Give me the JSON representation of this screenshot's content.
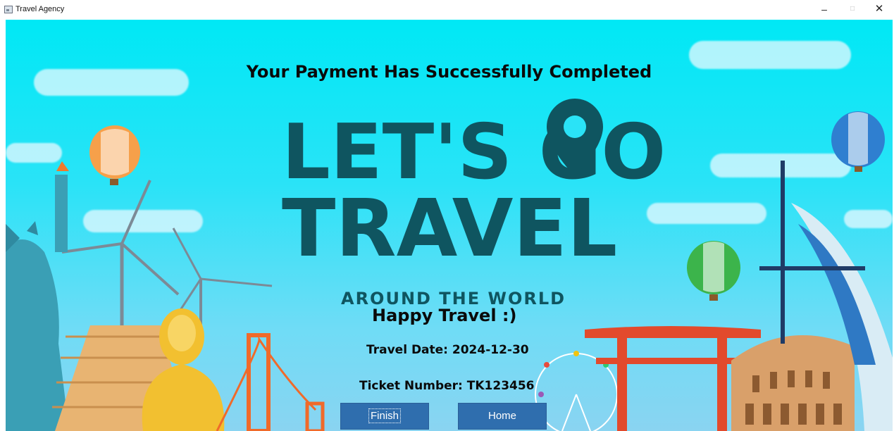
{
  "window": {
    "title": "Travel Agency",
    "controls": {
      "minimize": "–",
      "maximize": "□",
      "close": "✕"
    }
  },
  "content": {
    "headline": "Your Payment Has Successfully Completed",
    "logo": {
      "line1": "LET'S GO",
      "line2": "TRAVEL",
      "tagline": "AROUND THE WORLD"
    },
    "happy_text": "Happy Travel :)",
    "travel_date": "Travel Date: 2024-12-30",
    "ticket_number": "Ticket Number: TK123456"
  },
  "buttons": {
    "finish": "Finish",
    "home": "Home"
  },
  "colors": {
    "sky_top": "#00e8f5",
    "logo": "#0f5560",
    "button": "#2f6eae",
    "text": "#0a0a0a"
  },
  "decorations": [
    "statue-of-liberty",
    "wind-turbines",
    "hot-air-balloons",
    "pyramid",
    "buddha-statue",
    "golden-gate-bridge",
    "ferris-wheel",
    "torii-gate",
    "colosseum",
    "burj-al-arab"
  ]
}
